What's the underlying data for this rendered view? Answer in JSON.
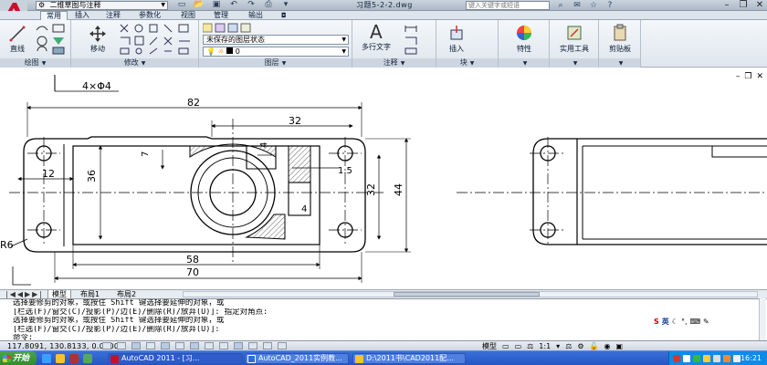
{
  "titlebar": {
    "workspace": "二维草图与注释",
    "document_title": "习题5-2-2.dwg",
    "search_placeholder": "键入关键字或短语"
  },
  "ribbon_tabs": [
    "常用",
    "插入",
    "注释",
    "参数化",
    "视图",
    "管理",
    "输出"
  ],
  "ribbon": {
    "draw": {
      "line_label": "直线",
      "panel_title": "绘图"
    },
    "modify": {
      "move_label": "移动",
      "panel_title": "修改"
    },
    "layers": {
      "layer_state": "未保存的图层状态",
      "current_layer": "0",
      "panel_title": "图层"
    },
    "annotation": {
      "mtext_label": "多行文字",
      "panel_title": "注释"
    },
    "block": {
      "insert_label": "插入",
      "panel_title": "块"
    },
    "properties_label": "特性",
    "utilities_label": "实用工具",
    "clipboard_label": "剪贴板"
  },
  "drawing": {
    "dims": {
      "holes": "4×Φ4",
      "width82": "82",
      "width32": "32",
      "height36": "36",
      "w12": "12",
      "r7": "7",
      "d4a": "4",
      "d15": "1.5",
      "h32": "32",
      "h44": "44",
      "d4b": "4",
      "w58": "58",
      "w70": "70",
      "r6": "R6"
    }
  },
  "model_tabs": [
    "模型",
    "布局1",
    "布局2"
  ],
  "command_lines": [
    "选择要修剪的对象，或按住 Shift 键选择要延伸的对象，或",
    "[栏选(F)/窗交(C)/投影(P)/边(E)/删除(R)/放弃(U)]:  指定对角点:",
    "选择要修剪的对象，或按住 Shift 键选择要延伸的对象，或",
    "[栏选(F)/窗交(C)/投影(P)/边(E)/删除(R)/放弃(U)]:",
    "命令:"
  ],
  "ime": {
    "lang": "英"
  },
  "status": {
    "coords": "117.8091, 130.8133, 0.0000",
    "model_label": "模型",
    "scale": "1:1"
  },
  "taskbar": {
    "start": "开始",
    "tasks": [
      "AutoCAD 2011 - [习...",
      "AutoCAD_2011实例教...",
      "D:\\2011书\\CAD2011配..."
    ],
    "clock": "16:21"
  },
  "colors": {
    "accent": "#2456c4",
    "logo_red": "#c8102e"
  }
}
